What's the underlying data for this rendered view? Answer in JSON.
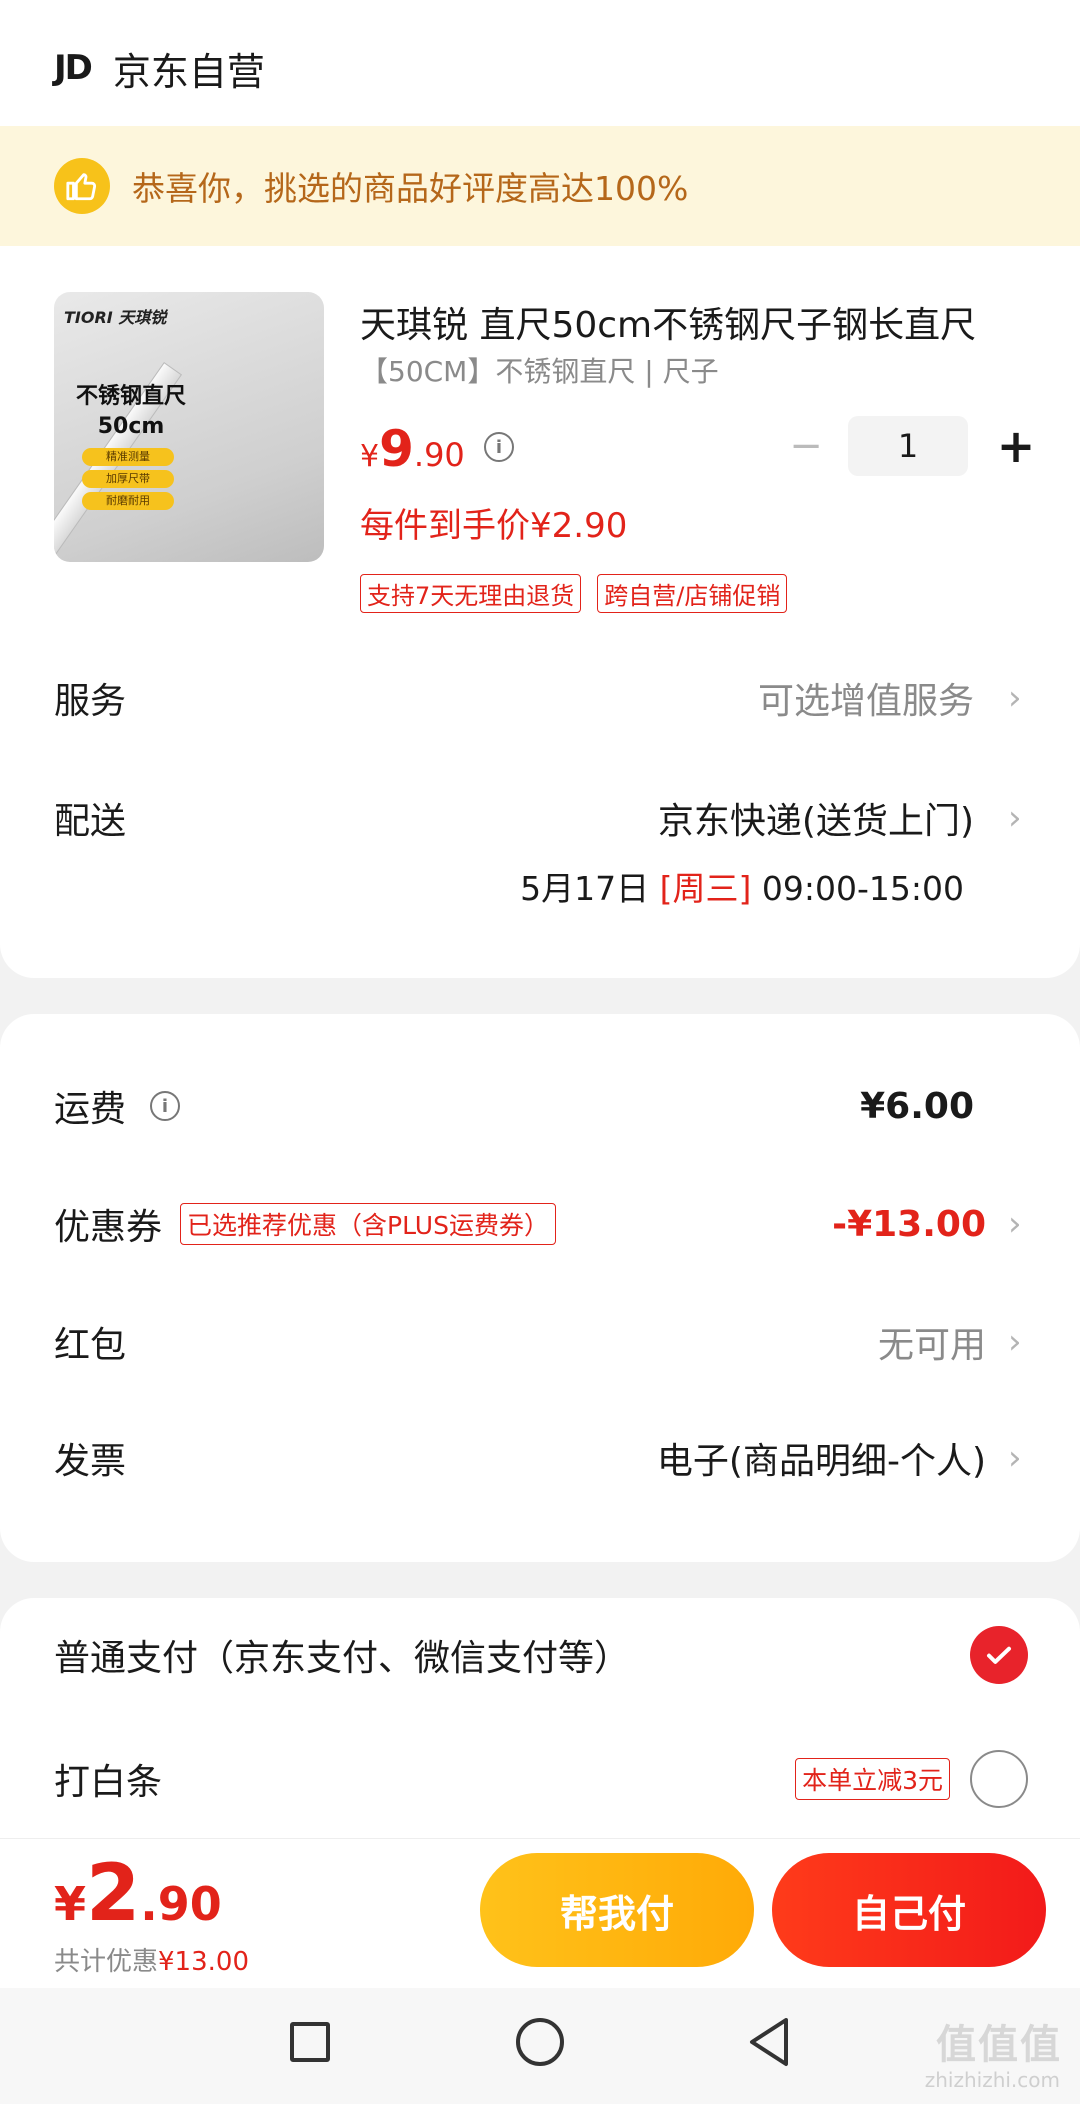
{
  "store": {
    "logo": "JD",
    "name": "京东自营"
  },
  "banner": {
    "text": "恭喜你，挑选的商品好评度高达100%"
  },
  "product": {
    "image_brand": "TIORI 天琪锐",
    "image_title": "不锈钢直尺 50cm",
    "image_pills": [
      "精准测量",
      "加厚尺带",
      "耐磨耐用"
    ],
    "title": "天琪锐 直尺50cm不锈钢尺子钢长直尺",
    "spec": "【50CM】不锈钢直尺 | 尺子",
    "price_symbol": "¥",
    "price_int": "9",
    "price_dec": ".90",
    "quantity": "1",
    "minus": "−",
    "plus": "+",
    "unit_price": "每件到手价¥2.90",
    "tags": [
      "支持7天无理由退货",
      "跨自营/店铺促销"
    ]
  },
  "service": {
    "label": "服务",
    "value": "可选增值服务"
  },
  "delivery": {
    "label": "配送",
    "method": "京东快递(送货上门)",
    "date": "5月17日",
    "weekday": "[周三]",
    "time": "09:00-15:00"
  },
  "fees": {
    "shipping_label": "运费",
    "shipping_value": "¥6.00",
    "coupon_label": "优惠券",
    "coupon_tag": "已选推荐优惠（含PLUS运费券）",
    "coupon_value": "-¥13.00",
    "redpacket_label": "红包",
    "redpacket_value": "无可用",
    "invoice_label": "发票",
    "invoice_value": "电子(商品明细-个人)"
  },
  "payment": {
    "normal_label": "普通支付（京东支付、微信支付等）",
    "baitiao_label": "打白条",
    "baitiao_tag": "本单立减3元"
  },
  "summary": {
    "price_symbol": "¥",
    "price_int": "2",
    "price_dec": ".90",
    "discount_label": "共计优惠",
    "discount_value": "¥13.00",
    "help_pay": "帮我付",
    "self_pay": "自己付"
  },
  "watermark": {
    "main": "值值值",
    "sub": "zhizhizhi.com"
  },
  "colors": {
    "accent_red": "#e2231a",
    "button_yellow": "#ffb50f",
    "banner_bg": "#fdf6dc"
  },
  "icons": [
    "thumbs-up-icon",
    "info-icon",
    "chevron-right-icon",
    "check-icon",
    "nav-square-icon",
    "nav-circle-icon",
    "nav-back-icon"
  ]
}
